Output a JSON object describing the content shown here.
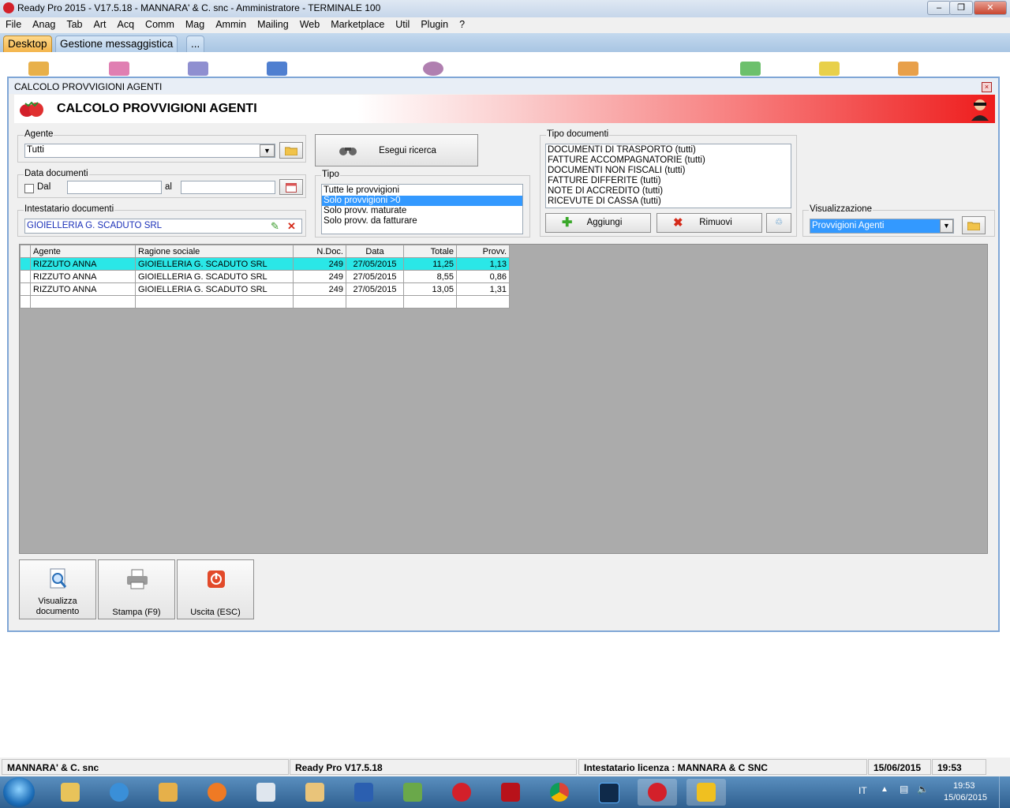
{
  "titlebar": {
    "title": "Ready Pro 2015 - V17.5.18 - MANNARA' & C. snc - Amministratore - TERMINALE 100",
    "min": "–",
    "max": "❐",
    "close": "✕"
  },
  "menu": [
    "File",
    "Anag",
    "Tab",
    "Art",
    "Acq",
    "Comm",
    "Mag",
    "Ammin",
    "Mailing",
    "Web",
    "Marketplace",
    "Util",
    "Plugin",
    "?"
  ],
  "tabs": {
    "desktop": "Desktop",
    "messaggistica": "Gestione messaggistica",
    "more": "..."
  },
  "window": {
    "caption": "CALCOLO PROVVIGIONI AGENTI",
    "banner_title": "CALCOLO PROVVIGIONI AGENTI",
    "agente": {
      "legend": "Agente",
      "value": "Tutti"
    },
    "data_documenti": {
      "legend": "Data documenti",
      "dal_label": "Dal",
      "al_label": "al",
      "dal_value": "",
      "al_value": ""
    },
    "intestatario": {
      "legend": "Intestatario documenti",
      "value": "GIOIELLERIA G. SCADUTO SRL"
    },
    "esegui_ricerca": "Esegui ricerca",
    "tipo": {
      "legend": "Tipo",
      "options": [
        "Tutte le provvigioni",
        "Solo provvigioni >0",
        "Solo provv. maturate",
        "Solo provv. da fatturare"
      ],
      "selected": "Solo provvigioni >0"
    },
    "tipo_documenti": {
      "legend": "Tipo documenti",
      "items": [
        "DOCUMENTI DI TRASPORTO (tutti)",
        "FATTURE ACCOMPAGNATORIE (tutti)",
        "DOCUMENTI NON FISCALI (tutti)",
        "FATTURE DIFFERITE (tutti)",
        "NOTE DI ACCREDITO (tutti)",
        "RICEVUTE DI CASSA (tutti)"
      ],
      "aggiungi": "Aggiungi",
      "rimuovi": "Rimuovi"
    },
    "visualizzazione": {
      "legend": "Visualizzazione",
      "value": "Provvigioni Agenti"
    },
    "grid": {
      "columns": [
        "Agente",
        "Ragione sociale",
        "N.Doc.",
        "Data",
        "Totale",
        "Provv."
      ],
      "rows": [
        [
          "RIZZUTO ANNA",
          "GIOIELLERIA G. SCADUTO SRL",
          "249",
          "27/05/2015",
          "11,25",
          "1,13"
        ],
        [
          "RIZZUTO ANNA",
          "GIOIELLERIA G. SCADUTO SRL",
          "249",
          "27/05/2015",
          "8,55",
          "0,86"
        ],
        [
          "RIZZUTO ANNA",
          "GIOIELLERIA G. SCADUTO SRL",
          "249",
          "27/05/2015",
          "13,05",
          "1,31"
        ]
      ]
    },
    "buttons": {
      "visualizza": "Visualizza documento",
      "stampa": "Stampa (F9)",
      "uscita": "Uscita (ESC)"
    }
  },
  "statusbar": {
    "company": "MANNARA' & C. snc",
    "version": "Ready Pro V17.5.18",
    "license": "Intestatario licenza : MANNARA & C SNC",
    "date": "15/06/2015",
    "time": "19:53"
  },
  "taskbar": {
    "lang": "IT",
    "clock_time": "19:53",
    "clock_date": "15/06/2015"
  },
  "colors": {
    "highlight_row": "#2ae7e7",
    "selection": "#3399ff",
    "banner_red": "#ee1c1c"
  }
}
